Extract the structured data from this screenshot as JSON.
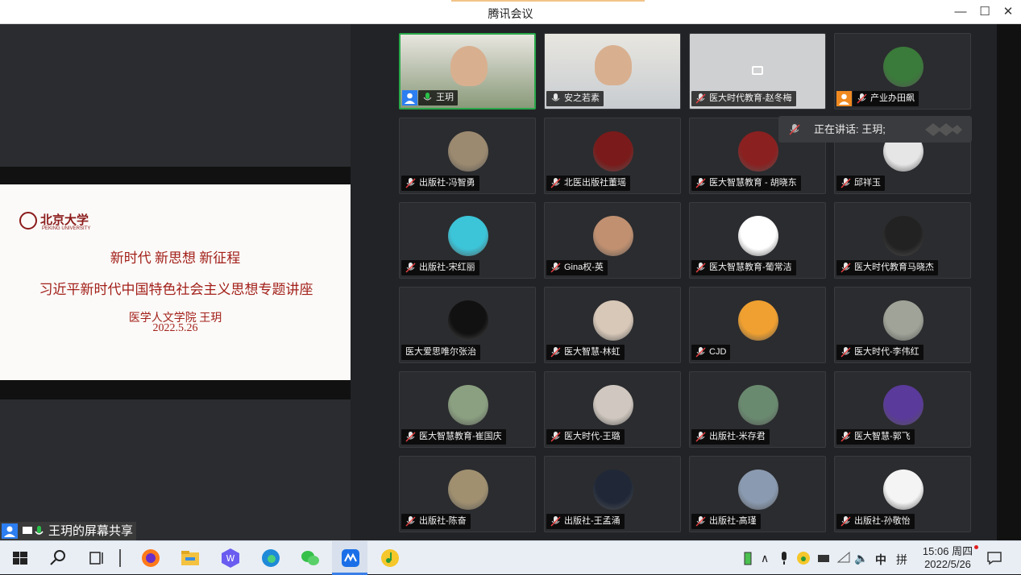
{
  "window": {
    "title": "腾讯会议"
  },
  "slide": {
    "logo_text": "北京大学",
    "logo_sub": "PEKING UNIVERSITY",
    "line1": "新时代 新思想 新征程",
    "line2": "习近平新时代中国特色社会主义思想专题讲座",
    "line3": "医学人文学院 王玥",
    "line4": "2022.5.26"
  },
  "share_label": "王玥的屏幕共享",
  "speaking": "正在讲话: 王玥;",
  "participants": [
    {
      "name": "王玥",
      "mic": "on",
      "host": true,
      "avatar": "video-feed",
      "color": "#8a9a7a"
    },
    {
      "name": "安之若素",
      "mic": "plain",
      "avatar": "video-feed",
      "color": "#c8ccd0"
    },
    {
      "name": "医大时代教育-赵冬梅",
      "mic": "muted",
      "avatar": "camera-off",
      "color": "#cfd0d2"
    },
    {
      "name": "产业办田飙",
      "mic": "muted",
      "host": true,
      "avatar": "photo",
      "color": "#3a7a3a"
    },
    {
      "name": "出版社-冯智勇",
      "mic": "muted",
      "avatar": "photo",
      "color": "#9c8a70"
    },
    {
      "name": "北医出版社董瑶",
      "mic": "muted",
      "avatar": "photo",
      "color": "#7a1a1a"
    },
    {
      "name": "医大智慧教育 - 胡晓东",
      "mic": "muted",
      "avatar": "photo",
      "color": "#8a2020"
    },
    {
      "name": "邱祥玉",
      "mic": "muted",
      "avatar": "photo",
      "color": "#e6e6e6"
    },
    {
      "name": "出版社-宋红丽",
      "mic": "muted",
      "avatar": "photo",
      "color": "#3cc4d8"
    },
    {
      "name": "Gina权-英",
      "mic": "muted",
      "avatar": "photo",
      "color": "#c09070"
    },
    {
      "name": "医大智慧教育-葡常洁",
      "mic": "muted",
      "avatar": "photo",
      "color": "#ffffff"
    },
    {
      "name": "医大时代教育马晓杰",
      "mic": "muted",
      "avatar": "photo",
      "color": "#222222"
    },
    {
      "name": "医大爱思唯尔张治",
      "mic": "none",
      "avatar": "photo",
      "color": "#111111"
    },
    {
      "name": "医大智慧-林虹",
      "mic": "muted",
      "avatar": "photo",
      "color": "#d8c8b8"
    },
    {
      "name": "CJD",
      "mic": "muted",
      "avatar": "photo",
      "color": "#f0a030"
    },
    {
      "name": "医大时代-李伟红",
      "mic": "muted",
      "avatar": "photo",
      "color": "#a0a498"
    },
    {
      "name": "医大智慧教育-崔国庆",
      "mic": "muted",
      "avatar": "photo",
      "color": "#8aa080"
    },
    {
      "name": "医大时代-王璐",
      "mic": "muted",
      "avatar": "photo",
      "color": "#d0c8c0"
    },
    {
      "name": "出版社-米存君",
      "mic": "muted",
      "avatar": "photo",
      "color": "#6a8a70"
    },
    {
      "name": "医大智慧-郭飞",
      "mic": "muted",
      "avatar": "photo",
      "color": "#5a3a9a"
    },
    {
      "name": "出版社-陈奋",
      "mic": "muted",
      "avatar": "photo",
      "color": "#a09070"
    },
    {
      "name": "出版社-王孟涌",
      "mic": "muted",
      "avatar": "photo",
      "color": "#202838"
    },
    {
      "name": "出版社-高瑾",
      "mic": "muted",
      "avatar": "photo",
      "color": "#8a9ab0"
    },
    {
      "name": "出版社-孙敬怡",
      "mic": "muted",
      "avatar": "photo",
      "color": "#f4f4f4"
    }
  ],
  "taskbar": {
    "time": "15:06 周四",
    "date": "2022/5/26",
    "ime1": "中",
    "ime2": "拼",
    "apps": [
      "start-icon",
      "search-icon",
      "task-view-icon",
      "firefox-icon",
      "file-explorer-icon",
      "wps-icon",
      "edge-icon",
      "wechat-icon",
      "tencent-meeting-icon",
      "qq-music-icon"
    ]
  }
}
